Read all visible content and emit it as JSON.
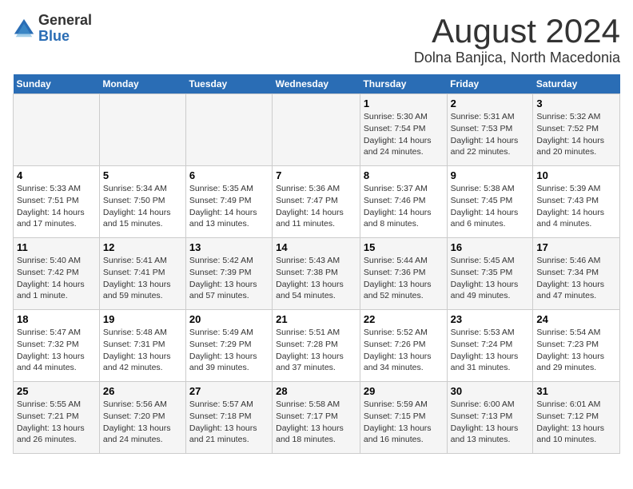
{
  "header": {
    "logo_general": "General",
    "logo_blue": "Blue",
    "main_title": "August 2024",
    "sub_title": "Dolna Banjica, North Macedonia"
  },
  "days_of_week": [
    "Sunday",
    "Monday",
    "Tuesday",
    "Wednesday",
    "Thursday",
    "Friday",
    "Saturday"
  ],
  "weeks": [
    [
      {
        "day": "",
        "text": ""
      },
      {
        "day": "",
        "text": ""
      },
      {
        "day": "",
        "text": ""
      },
      {
        "day": "",
        "text": ""
      },
      {
        "day": "1",
        "text": "Sunrise: 5:30 AM\nSunset: 7:54 PM\nDaylight: 14 hours and 24 minutes."
      },
      {
        "day": "2",
        "text": "Sunrise: 5:31 AM\nSunset: 7:53 PM\nDaylight: 14 hours and 22 minutes."
      },
      {
        "day": "3",
        "text": "Sunrise: 5:32 AM\nSunset: 7:52 PM\nDaylight: 14 hours and 20 minutes."
      }
    ],
    [
      {
        "day": "4",
        "text": "Sunrise: 5:33 AM\nSunset: 7:51 PM\nDaylight: 14 hours and 17 minutes."
      },
      {
        "day": "5",
        "text": "Sunrise: 5:34 AM\nSunset: 7:50 PM\nDaylight: 14 hours and 15 minutes."
      },
      {
        "day": "6",
        "text": "Sunrise: 5:35 AM\nSunset: 7:49 PM\nDaylight: 14 hours and 13 minutes."
      },
      {
        "day": "7",
        "text": "Sunrise: 5:36 AM\nSunset: 7:47 PM\nDaylight: 14 hours and 11 minutes."
      },
      {
        "day": "8",
        "text": "Sunrise: 5:37 AM\nSunset: 7:46 PM\nDaylight: 14 hours and 8 minutes."
      },
      {
        "day": "9",
        "text": "Sunrise: 5:38 AM\nSunset: 7:45 PM\nDaylight: 14 hours and 6 minutes."
      },
      {
        "day": "10",
        "text": "Sunrise: 5:39 AM\nSunset: 7:43 PM\nDaylight: 14 hours and 4 minutes."
      }
    ],
    [
      {
        "day": "11",
        "text": "Sunrise: 5:40 AM\nSunset: 7:42 PM\nDaylight: 14 hours and 1 minute."
      },
      {
        "day": "12",
        "text": "Sunrise: 5:41 AM\nSunset: 7:41 PM\nDaylight: 13 hours and 59 minutes."
      },
      {
        "day": "13",
        "text": "Sunrise: 5:42 AM\nSunset: 7:39 PM\nDaylight: 13 hours and 57 minutes."
      },
      {
        "day": "14",
        "text": "Sunrise: 5:43 AM\nSunset: 7:38 PM\nDaylight: 13 hours and 54 minutes."
      },
      {
        "day": "15",
        "text": "Sunrise: 5:44 AM\nSunset: 7:36 PM\nDaylight: 13 hours and 52 minutes."
      },
      {
        "day": "16",
        "text": "Sunrise: 5:45 AM\nSunset: 7:35 PM\nDaylight: 13 hours and 49 minutes."
      },
      {
        "day": "17",
        "text": "Sunrise: 5:46 AM\nSunset: 7:34 PM\nDaylight: 13 hours and 47 minutes."
      }
    ],
    [
      {
        "day": "18",
        "text": "Sunrise: 5:47 AM\nSunset: 7:32 PM\nDaylight: 13 hours and 44 minutes."
      },
      {
        "day": "19",
        "text": "Sunrise: 5:48 AM\nSunset: 7:31 PM\nDaylight: 13 hours and 42 minutes."
      },
      {
        "day": "20",
        "text": "Sunrise: 5:49 AM\nSunset: 7:29 PM\nDaylight: 13 hours and 39 minutes."
      },
      {
        "day": "21",
        "text": "Sunrise: 5:51 AM\nSunset: 7:28 PM\nDaylight: 13 hours and 37 minutes."
      },
      {
        "day": "22",
        "text": "Sunrise: 5:52 AM\nSunset: 7:26 PM\nDaylight: 13 hours and 34 minutes."
      },
      {
        "day": "23",
        "text": "Sunrise: 5:53 AM\nSunset: 7:24 PM\nDaylight: 13 hours and 31 minutes."
      },
      {
        "day": "24",
        "text": "Sunrise: 5:54 AM\nSunset: 7:23 PM\nDaylight: 13 hours and 29 minutes."
      }
    ],
    [
      {
        "day": "25",
        "text": "Sunrise: 5:55 AM\nSunset: 7:21 PM\nDaylight: 13 hours and 26 minutes."
      },
      {
        "day": "26",
        "text": "Sunrise: 5:56 AM\nSunset: 7:20 PM\nDaylight: 13 hours and 24 minutes."
      },
      {
        "day": "27",
        "text": "Sunrise: 5:57 AM\nSunset: 7:18 PM\nDaylight: 13 hours and 21 minutes."
      },
      {
        "day": "28",
        "text": "Sunrise: 5:58 AM\nSunset: 7:17 PM\nDaylight: 13 hours and 18 minutes."
      },
      {
        "day": "29",
        "text": "Sunrise: 5:59 AM\nSunset: 7:15 PM\nDaylight: 13 hours and 16 minutes."
      },
      {
        "day": "30",
        "text": "Sunrise: 6:00 AM\nSunset: 7:13 PM\nDaylight: 13 hours and 13 minutes."
      },
      {
        "day": "31",
        "text": "Sunrise: 6:01 AM\nSunset: 7:12 PM\nDaylight: 13 hours and 10 minutes."
      }
    ]
  ]
}
